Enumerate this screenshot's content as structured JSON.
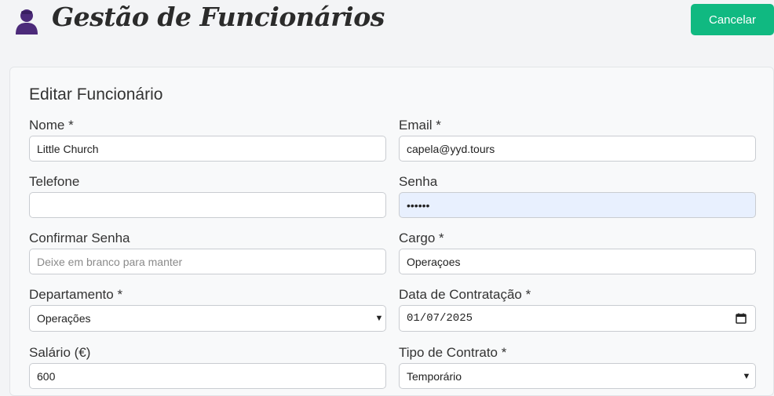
{
  "header": {
    "app_title": "Gestão de Funcionários",
    "cancel_label": "Cancelar"
  },
  "form": {
    "title": "Editar Funcionário",
    "fields": {
      "nome": {
        "label": "Nome *",
        "value": "Little Church"
      },
      "email": {
        "label": "Email *",
        "value": "capela@yyd.tours"
      },
      "telefone": {
        "label": "Telefone",
        "value": ""
      },
      "senha": {
        "label": "Senha",
        "value": "••••••"
      },
      "confirmar_senha": {
        "label": "Confirmar Senha",
        "placeholder": "Deixe em branco para manter",
        "value": ""
      },
      "cargo": {
        "label": "Cargo *",
        "value": "Operaçoes"
      },
      "departamento": {
        "label": "Departamento *",
        "selected": "Operações"
      },
      "data_contratacao": {
        "label": "Data de Contratação *",
        "value": "01/07/2025"
      },
      "salario": {
        "label": "Salário (€)",
        "value": "600"
      },
      "tipo_contrato": {
        "label": "Tipo de Contrato *",
        "selected": "Temporário"
      }
    }
  },
  "icons": {
    "logo": "user-icon",
    "calendar": "calendar-icon",
    "select_arrow": "chevron-down-icon"
  },
  "colors": {
    "accent": "#10b981",
    "logo": "#4c2a7a",
    "autofill": "#e8f0fe"
  }
}
